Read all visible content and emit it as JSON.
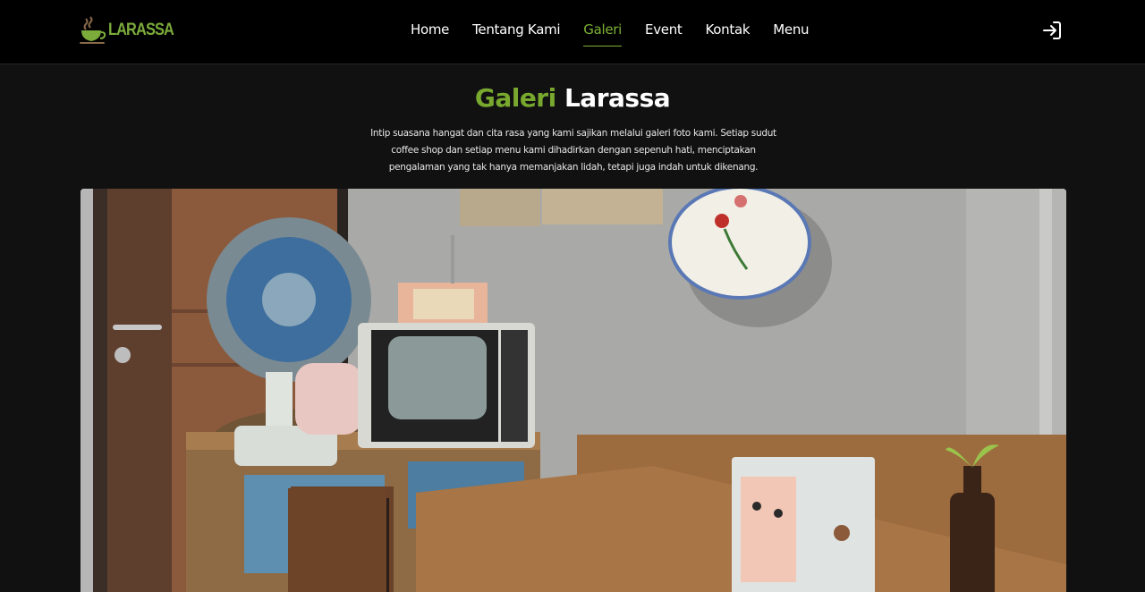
{
  "brand": {
    "name": "LARASSA",
    "accent_color": "#7cb134"
  },
  "nav": {
    "items": [
      {
        "label": "Home",
        "active": false
      },
      {
        "label": "Tentang Kami",
        "active": false
      },
      {
        "label": "Galeri",
        "active": true
      },
      {
        "label": "Event",
        "active": false
      },
      {
        "label": "Kontak",
        "active": false
      },
      {
        "label": "Menu",
        "active": false
      }
    ],
    "login_icon": "login-icon"
  },
  "gallery": {
    "title_accent": "Galeri",
    "title_rest": "Larassa",
    "description": "Intip suasana hangat dan cita rasa yang kami sajikan melalui galeri foto kami. Setiap sudut coffee shop dan setiap menu kami dihadirkan dengan sepenuh hati, menciptakan pengalaman yang tak hanya memanjakan lidah, tetapi juga indah untuk dikenang."
  }
}
